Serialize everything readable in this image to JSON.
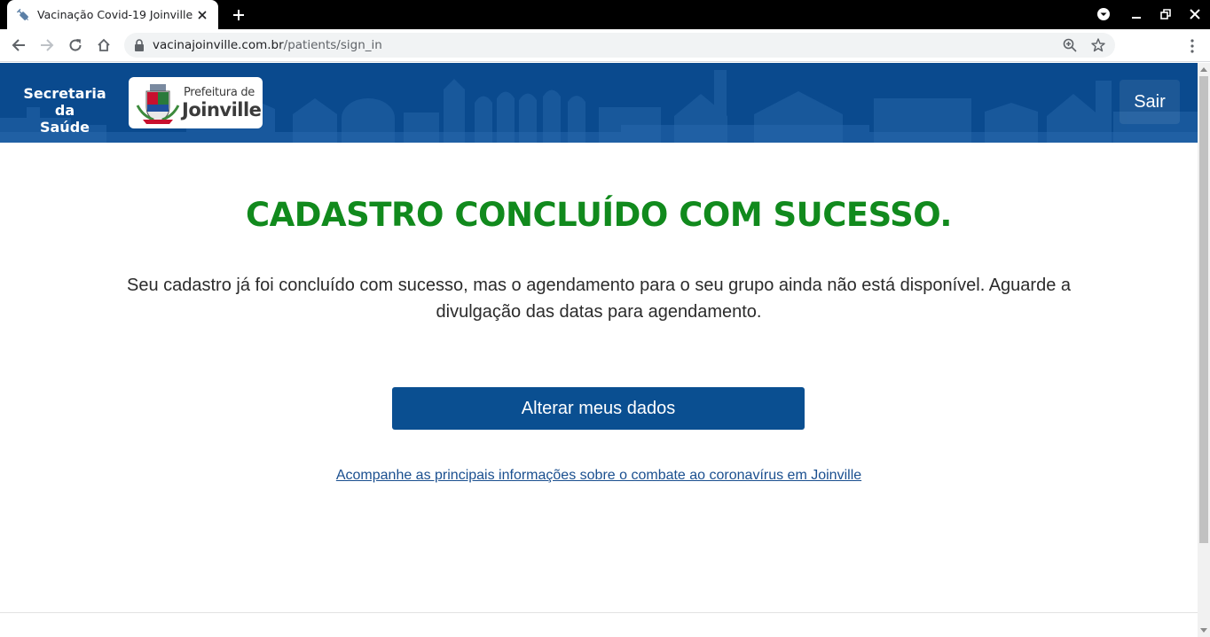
{
  "browser": {
    "tab_title": "Vacinação Covid-19 Joinville",
    "url_host": "vacinajoinville.com.br",
    "url_path": "/patients/sign_in"
  },
  "header": {
    "secretaria_line1": "Secretaria da",
    "secretaria_line2": "Saúde",
    "prefeitura_small": "Prefeitura de",
    "prefeitura_big": "Joinville",
    "logout_label": "Sair",
    "background_color": "#0a4a8e"
  },
  "main": {
    "title": "CADASTRO CONCLUÍDO COM SUCESSO.",
    "message": "Seu cadastro já foi concluído com sucesso, mas o agendamento para o seu grupo ainda não está disponível. Aguarde a divulgação das datas para agendamento.",
    "edit_button_label": "Alterar meus dados",
    "info_link_text": "Acompanhe as principais informações sobre o combate ao coronavírus em Joinville",
    "title_color": "#118a1d",
    "button_color": "#0a4f91"
  },
  "icons": {
    "tab_favicon": "syringe-icon",
    "tab_close": "close-icon",
    "new_tab": "plus-icon",
    "back": "back-arrow-icon",
    "forward": "forward-arrow-icon",
    "reload": "reload-icon",
    "home": "home-icon",
    "lock": "lock-icon",
    "zoom": "zoom-icon",
    "bookmark": "star-icon",
    "menu": "kebab-menu-icon"
  }
}
